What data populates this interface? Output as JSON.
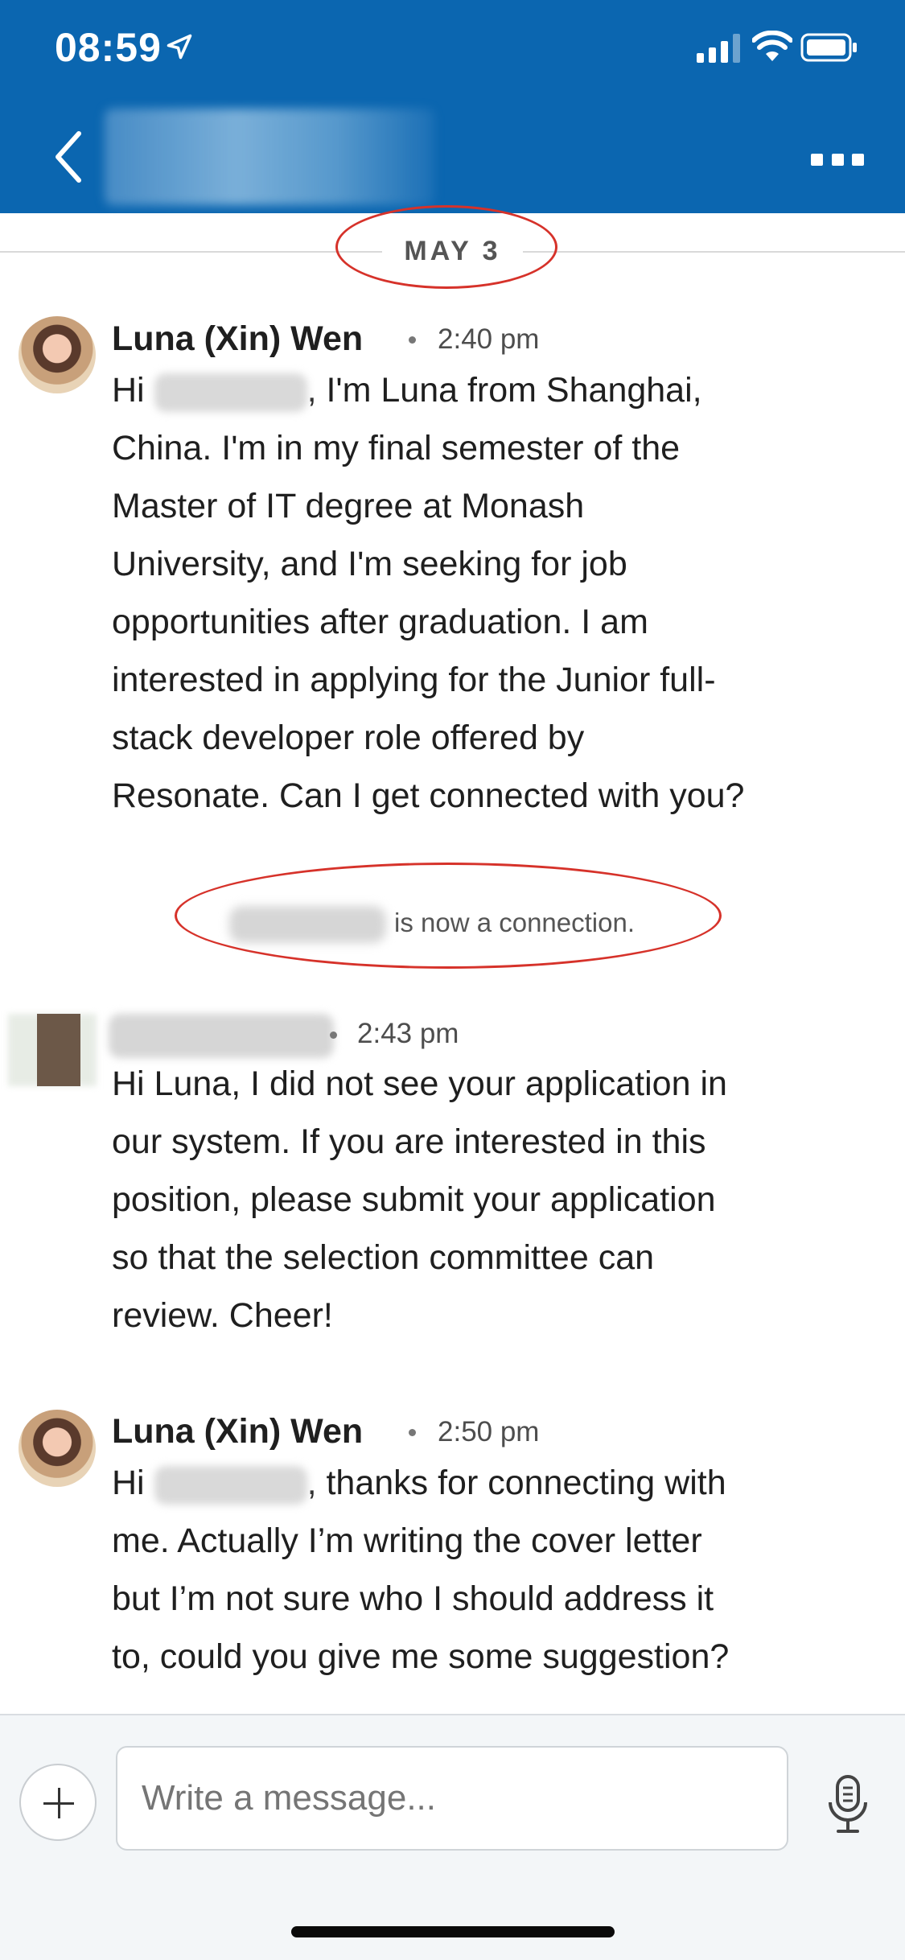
{
  "status_bar": {
    "time": "08:59"
  },
  "header": {
    "back_icon": "chevron-left-icon",
    "more_icon": "ellipsis-icon"
  },
  "date_divider": {
    "label": "MAY 3"
  },
  "messages": [
    {
      "sender": "Luna (Xin) Wen",
      "time": "2:40 pm",
      "lines": [
        "Hi ",
        ", I'm Luna from Shanghai,",
        "China. I'm in my final semester of the",
        "Master of IT degree at Monash",
        "University, and I'm seeking for job",
        "opportunities after graduation. I am",
        "interested in applying for the Junior full-",
        "stack developer role offered by",
        "Resonate. Can I get connected with you?"
      ]
    },
    {
      "sender": "",
      "time": "2:43 pm",
      "lines": [
        "Hi Luna, I did not see your application in",
        "our system. If you are interested in this",
        "position, please submit your application",
        "so that the selection committee can",
        "review. Cheer!"
      ]
    },
    {
      "sender": "Luna (Xin) Wen",
      "time": "2:50 pm",
      "lines": [
        "Hi ",
        ", thanks for connecting with",
        "me. Actually I’m writing the cover letter",
        "but I’m not sure who I should address it",
        "to, could you give me some suggestion?"
      ]
    }
  ],
  "connection_note": {
    "text": "is now a connection."
  },
  "composer": {
    "placeholder": "Write a message..."
  },
  "colors": {
    "header_bg": "#0b66b0",
    "annotation_red": "#d6322a"
  }
}
